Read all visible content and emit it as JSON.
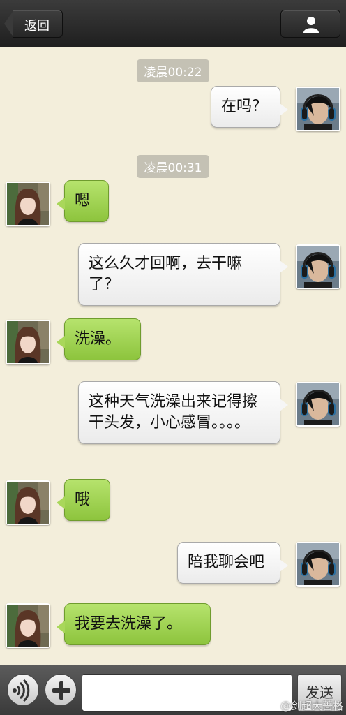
{
  "header": {
    "back_label": "返回",
    "profile_icon": "person-icon"
  },
  "timestamps": [
    "凌晨00:22",
    "凌晨00:31"
  ],
  "messages": [
    {
      "from": "me",
      "text": "在吗？"
    },
    {
      "from": "them",
      "text": "嗯"
    },
    {
      "from": "me",
      "text": "这么久才回啊，去干嘛了？"
    },
    {
      "from": "them",
      "text": "洗澡。"
    },
    {
      "from": "me",
      "text": "这种天气洗澡出来记得擦干头发，小心感冒。。。。"
    },
    {
      "from": "them",
      "text": "哦"
    },
    {
      "from": "me",
      "text": "陪我聊会吧"
    },
    {
      "from": "them",
      "text": "我要去洗澡了。"
    }
  ],
  "input": {
    "voice_icon": "voice-icon",
    "plus_icon": "plus-icon",
    "value": "",
    "send_label": "发送"
  },
  "watermark": "@剑超大蔷格",
  "colors": {
    "background": "#f3eedb",
    "header": "#2b2b2b",
    "incoming_bubble": "#a9d75a",
    "outgoing_bubble": "#ffffff",
    "timestamp_bg": "#c4c1b4"
  }
}
